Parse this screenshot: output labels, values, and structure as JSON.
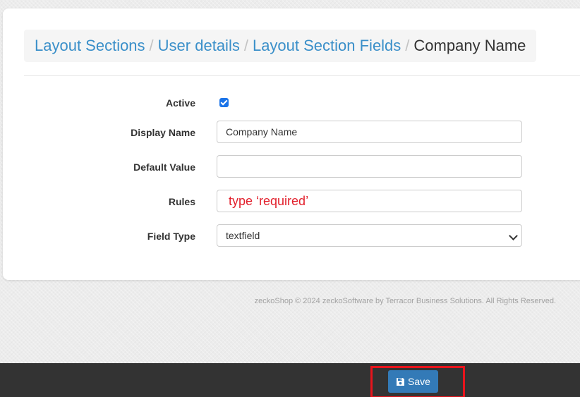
{
  "breadcrumb": {
    "items": [
      {
        "label": "Layout Sections"
      },
      {
        "label": "User details"
      },
      {
        "label": "Layout Section Fields"
      }
    ],
    "separator": "/",
    "current": "Company Name"
  },
  "form": {
    "active": {
      "label": "Active",
      "checked": true
    },
    "display_name": {
      "label": "Display Name",
      "value": "Company Name"
    },
    "default_value": {
      "label": "Default Value",
      "value": ""
    },
    "rules": {
      "label": "Rules",
      "value": "type ‘required’"
    },
    "field_type": {
      "label": "Field Type",
      "selected": "textfield"
    }
  },
  "footer": {
    "copyright": "zeckoShop © 2024 zeckoSoftware by Terracor Business Solutions. All Rights Reserved."
  },
  "actions": {
    "save_label": "Save",
    "save_icon": "floppy-disk-icon"
  },
  "colors": {
    "link": "#3a8fc9",
    "primary_button": "#337ab7",
    "bottom_bar": "#333333",
    "highlight": "#e8141c",
    "annotation_text": "#e2202c"
  }
}
